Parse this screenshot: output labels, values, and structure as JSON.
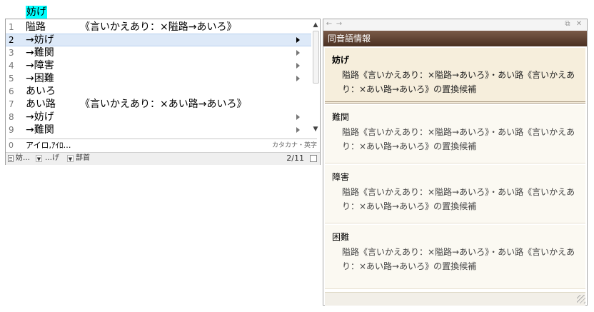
{
  "composition": "妨げ",
  "candidates": {
    "items": [
      {
        "num": "1",
        "text": "隘路",
        "annotation": "《言いかえあり：×隘路→あいろ》",
        "has_submenu": false,
        "selected": false
      },
      {
        "num": "2",
        "text": "→妨げ",
        "annotation": "",
        "has_submenu": true,
        "selected": true
      },
      {
        "num": "3",
        "text": "→難関",
        "annotation": "",
        "has_submenu": true,
        "selected": false
      },
      {
        "num": "4",
        "text": "→障害",
        "annotation": "",
        "has_submenu": true,
        "selected": false
      },
      {
        "num": "5",
        "text": "→困難",
        "annotation": "",
        "has_submenu": true,
        "selected": false
      },
      {
        "num": "6",
        "text": "あいろ",
        "annotation": "",
        "has_submenu": false,
        "selected": false
      },
      {
        "num": "7",
        "text": "あい路",
        "annotation": "《言いかえあり：×あい路→あいろ》",
        "has_submenu": false,
        "selected": false
      },
      {
        "num": "8",
        "text": "→妨げ",
        "annotation": "",
        "has_submenu": true,
        "selected": false
      },
      {
        "num": "9",
        "text": "→難関",
        "annotation": "",
        "has_submenu": true,
        "selected": false
      }
    ],
    "zero_row": {
      "num": "0",
      "text": "アイロ,ｱｲﾛ…",
      "hint": "カタカナ・英字"
    },
    "status": {
      "seg1": "妨…",
      "seg2": "…げ",
      "seg3": "部首",
      "page": "2/11"
    }
  },
  "info": {
    "header": "同音語情報",
    "entries": [
      {
        "word": "妨げ",
        "desc": "隘路《言いかえあり：×隘路→あいろ》・あい路《言いかえあり：×あい路→あいろ》の置換候補",
        "selected": true
      },
      {
        "word": "難関",
        "desc": "隘路《言いかえあり：×隘路→あいろ》・あい路《言いかえあり：×あい路→あいろ》の置換候補",
        "selected": false
      },
      {
        "word": "障害",
        "desc": "隘路《言いかえあり：×隘路→あいろ》・あい路《言いかえあり：×あい路→あいろ》の置換候補",
        "selected": false
      },
      {
        "word": "困難",
        "desc": "隘路《言いかえあり：×隘路→あいろ》・あい路《言いかえあり：×あい路→あいろ》の置換候補",
        "selected": false
      }
    ]
  }
}
